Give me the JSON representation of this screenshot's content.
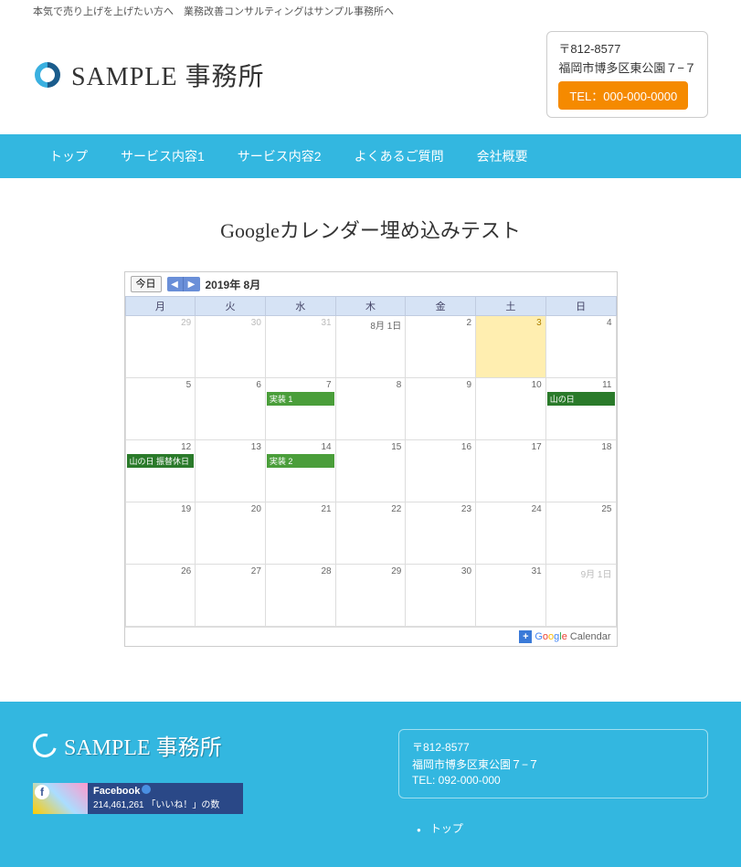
{
  "tagline": "本気で売り上げを上げたい方へ　業務改善コンサルティングはサンプル事務所へ",
  "logo_text": "SAMPLE 事務所",
  "contact": {
    "zip": "〒812-8577",
    "addr": "福岡市博多区東公園７−７",
    "tel_btn": "TEL：000-000-0000"
  },
  "nav": [
    "トップ",
    "サービス内容1",
    "サービス内容2",
    "よくあるご質問",
    "会社概要"
  ],
  "page_title": "Googleカレンダー埋め込みテスト",
  "calendar": {
    "today_btn": "今日",
    "title": "2019年 8月",
    "dow": [
      "月",
      "火",
      "水",
      "木",
      "金",
      "土",
      "日"
    ],
    "weeks": [
      [
        {
          "n": "29",
          "o": true
        },
        {
          "n": "30",
          "o": true
        },
        {
          "n": "31",
          "o": true
        },
        {
          "n": "8月 1日"
        },
        {
          "n": "2"
        },
        {
          "n": "3",
          "today": true
        },
        {
          "n": "4"
        }
      ],
      [
        {
          "n": "5"
        },
        {
          "n": "6"
        },
        {
          "n": "7",
          "ev": [
            {
              "t": "実装 1",
              "c": "ev-green"
            }
          ]
        },
        {
          "n": "8"
        },
        {
          "n": "9"
        },
        {
          "n": "10"
        },
        {
          "n": "11",
          "ev": [
            {
              "t": "山の日",
              "c": "ev-dgreen"
            }
          ]
        }
      ],
      [
        {
          "n": "12",
          "ev": [
            {
              "t": "山の日 振替休日",
              "c": "ev-dgreen"
            }
          ]
        },
        {
          "n": "13"
        },
        {
          "n": "14",
          "ev": [
            {
              "t": "実装 2",
              "c": "ev-green"
            }
          ]
        },
        {
          "n": "15"
        },
        {
          "n": "16"
        },
        {
          "n": "17"
        },
        {
          "n": "18"
        }
      ],
      [
        {
          "n": "19"
        },
        {
          "n": "20"
        },
        {
          "n": "21"
        },
        {
          "n": "22"
        },
        {
          "n": "23"
        },
        {
          "n": "24"
        },
        {
          "n": "25"
        }
      ],
      [
        {
          "n": "26"
        },
        {
          "n": "27"
        },
        {
          "n": "28"
        },
        {
          "n": "29"
        },
        {
          "n": "30"
        },
        {
          "n": "31"
        },
        {
          "n": "9月 1日",
          "o": true
        }
      ]
    ],
    "foot_word": "Calendar"
  },
  "footer": {
    "logo_text": "SAMPLE 事務所",
    "fb": {
      "name": "Facebook",
      "likes": "214,461,261 「いいね！」の数"
    },
    "contact": {
      "zip": "〒812-8577",
      "addr": "福岡市博多区東公園７−７",
      "tel": "TEL: 092-000-000"
    },
    "links": [
      "トップ"
    ]
  }
}
